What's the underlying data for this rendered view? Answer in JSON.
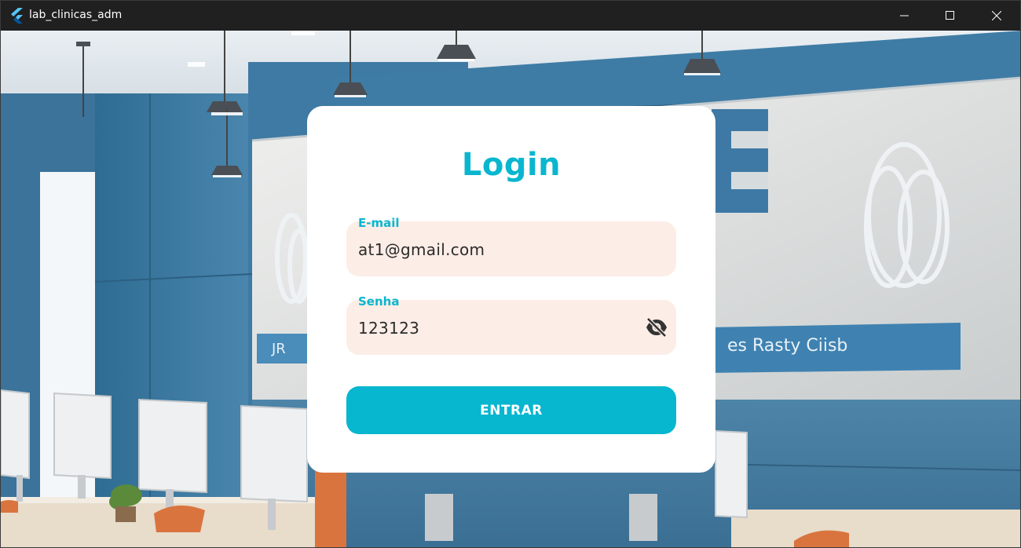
{
  "window": {
    "title": "lab_clinicas_adm",
    "app_icon": "flutter-icon",
    "controls": [
      "minimize-icon",
      "maximize-icon",
      "close-icon"
    ]
  },
  "background": {
    "wall_sign_text": "es Rasty Ciisb",
    "small_sign_text": "JR"
  },
  "login": {
    "title": "Login",
    "email": {
      "label": "E-mail",
      "value": "at1@gmail.com"
    },
    "password": {
      "label": "Senha",
      "value": "123123",
      "toggle_icon": "eye-off-icon"
    },
    "submit_label": "ENTRAR"
  },
  "colors": {
    "accent": "#07b6cf",
    "field_bg": "#fcede6",
    "card_bg": "#ffffff",
    "titlebar_bg": "#202020"
  }
}
